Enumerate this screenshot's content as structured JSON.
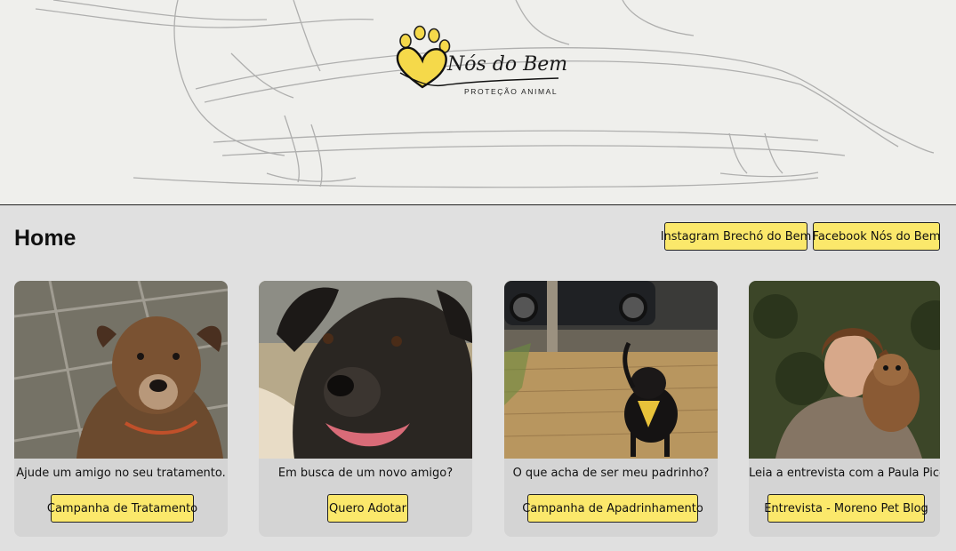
{
  "header": {
    "logo_title": "Nós do Bem",
    "logo_subtitle": "PROTEÇÃO ANIMAL"
  },
  "main": {
    "page_title": "Home",
    "external_links": [
      {
        "label": "Instagram Brechó do Bem"
      },
      {
        "label": "Facebook Nós do Bem"
      }
    ],
    "cards": [
      {
        "caption": "Ajude um amigo no seu tratamento.",
        "button": "Campanha de Tratamento"
      },
      {
        "caption": "Em busca de um novo amigo?",
        "button": "Quero Adotar"
      },
      {
        "caption": "O que acha de ser meu padrinho?",
        "button": "Campanha de Apadrinhamento"
      },
      {
        "caption": "Leia a entrevista com a Paula Picceli!",
        "button": "Entrevista - Moreno Pet Blog"
      }
    ]
  },
  "colors": {
    "accent_yellow": "#fbe86b",
    "page_background": "#e0e0e0",
    "card_background": "#d4d4d4"
  }
}
